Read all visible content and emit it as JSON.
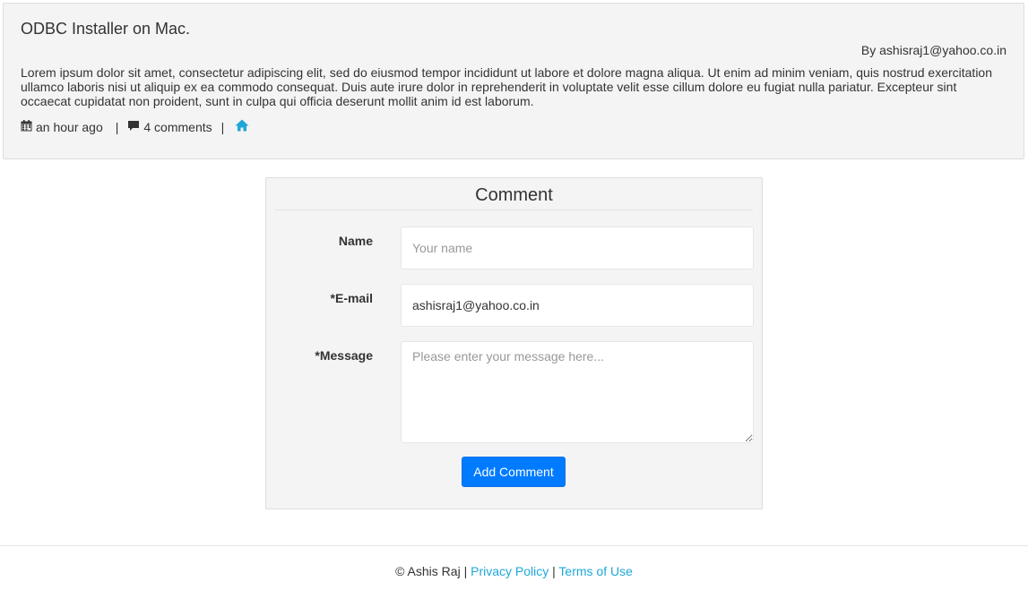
{
  "post": {
    "title": "ODBC Installer on Mac.",
    "author": "By ashisraj1@yahoo.co.in",
    "body": "Lorem ipsum dolor sit amet, consectetur adipiscing elit, sed do eiusmod tempor incididunt ut labore et dolore magna aliqua. Ut enim ad minim veniam, quis nostrud exercitation ullamco laboris nisi ut aliquip ex ea commodo consequat. Duis aute irure dolor in reprehenderit in voluptate velit esse cillum dolore eu fugiat nulla pariatur. Excepteur sint occaecat cupidatat non proident, sunt in culpa qui officia deserunt mollit anim id est laborum.",
    "meta": {
      "date_icon": "calendar-icon",
      "date": "an hour ago",
      "separator": "|",
      "comments_icon": "comment-icon",
      "comments": "4 comments",
      "home_icon": "home-icon"
    }
  },
  "comment_form": {
    "title": "Comment",
    "name_label": "Name",
    "name_placeholder": "Your name",
    "name_value": "",
    "email_label": "*E-mail",
    "email_value": "ashisraj1@yahoo.co.in",
    "message_label": "*Message",
    "message_placeholder": "Please enter your message here...",
    "message_value": "",
    "submit_label": "Add Comment"
  },
  "footer": {
    "copyright": "© Ashis Raj",
    "separator": "|",
    "privacy_label": "Privacy Policy",
    "terms_label": "Terms of Use"
  },
  "colors": {
    "accent": "#007bff",
    "link": "#1fa7d8",
    "panel_bg": "#f4f4f4"
  }
}
